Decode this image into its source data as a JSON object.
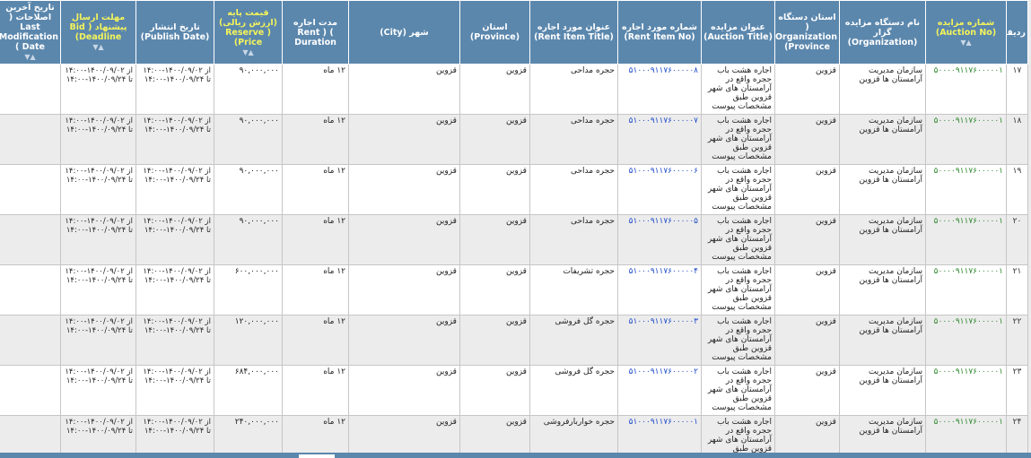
{
  "headers": {
    "row": "ردیف",
    "auction_no": "شماره مزایده (Auction No)",
    "org_name": "نام دستگاه مزایده گزار (Organization)",
    "org_province": "استان دستگاه ( Organization (Province",
    "auction_title": "عنوان مزایده (Auction Title)",
    "item_no": "شماره مورد اجاره (Rent Item No)",
    "item_title": "عنوان مورد اجاره (Rent Item Title)",
    "province": "استان (Province)",
    "city": "شهر (City)",
    "duration": "مدت اجاره Rent ) ( Duration",
    "price": "قیمت پایه (ارزش ریالی) ( Reserve (Price",
    "publish": "تاریخ انتشار (Publish Date)",
    "deadline": "مهلت ارسال پیشنهاد ( Bid (Deadline",
    "lastmod": "تاریخ آخرین اصلاحات ( Last Modification ( Date"
  },
  "rows": [
    {
      "rn": "۱۷",
      "auction_no": "۵۰۰۰۰۹۱۱۷۶۰۰۰۰۰۱",
      "org": "سازمان مدیریت آرامستان ها قزوین",
      "org_province": "قزوین",
      "title": "اجاره هشت باب حجره واقع در آرامستان های شهر قزوین طبق مشخصات پیوست",
      "item_no": "۵۱۰۰۰۹۱۱۷۶۰۰۰۰۰۸",
      "item_title": "حجره مداحی",
      "province": "قزوین",
      "city": "قزوین",
      "duration": "۱۲ ماه",
      "price": "۹۰,۰۰۰,۰۰۰",
      "publish_from": "از ۱۴۰۰/۰۹/۰۲-۱۴:۰۰",
      "publish_to": "تا ۱۴۰۰/۰۹/۲۴-۱۴:۰۰",
      "deadline_from": "از ۱۴۰۰/۰۹/۰۲-۱۴:۰۰",
      "deadline_to": "تا ۱۴۰۰/۰۹/۲۴-۱۴:۰۰",
      "lastmod": ""
    },
    {
      "rn": "۱۸",
      "auction_no": "۵۰۰۰۰۹۱۱۷۶۰۰۰۰۰۱",
      "org": "سازمان مدیریت آرامستان ها قزوین",
      "org_province": "قزوین",
      "title": "اجاره هشت باب حجره واقع در آرامستان های شهر قزوین طبق مشخصات پیوست",
      "item_no": "۵۱۰۰۰۹۱۱۷۶۰۰۰۰۰۷",
      "item_title": "حجره مداحی",
      "province": "قزوین",
      "city": "قزوین",
      "duration": "۱۲ ماه",
      "price": "۹۰,۰۰۰,۰۰۰",
      "publish_from": "از ۱۴۰۰/۰۹/۰۲-۱۴:۰۰",
      "publish_to": "تا ۱۴۰۰/۰۹/۲۴-۱۴:۰۰",
      "deadline_from": "از ۱۴۰۰/۰۹/۰۲-۱۴:۰۰",
      "deadline_to": "تا ۱۴۰۰/۰۹/۲۴-۱۴:۰۰",
      "lastmod": ""
    },
    {
      "rn": "۱۹",
      "auction_no": "۵۰۰۰۰۹۱۱۷۶۰۰۰۰۰۱",
      "org": "سازمان مدیریت آرامستان ها قزوین",
      "org_province": "قزوین",
      "title": "اجاره هشت باب حجره واقع در آرامستان های شهر قزوین طبق مشخصات پیوست",
      "item_no": "۵۱۰۰۰۹۱۱۷۶۰۰۰۰۰۶",
      "item_title": "حجره مداحی",
      "province": "قزوین",
      "city": "قزوین",
      "duration": "۱۲ ماه",
      "price": "۹۰,۰۰۰,۰۰۰",
      "publish_from": "از ۱۴۰۰/۰۹/۰۲-۱۴:۰۰",
      "publish_to": "تا ۱۴۰۰/۰۹/۲۴-۱۴:۰۰",
      "deadline_from": "از ۱۴۰۰/۰۹/۰۲-۱۴:۰۰",
      "deadline_to": "تا ۱۴۰۰/۰۹/۲۴-۱۴:۰۰",
      "lastmod": ""
    },
    {
      "rn": "۲۰",
      "auction_no": "۵۰۰۰۰۹۱۱۷۶۰۰۰۰۰۱",
      "org": "سازمان مدیریت آرامستان ها قزوین",
      "org_province": "قزوین",
      "title": "اجاره هشت باب حجره واقع در آرامستان های شهر قزوین طبق مشخصات پیوست",
      "item_no": "۵۱۰۰۰۹۱۱۷۶۰۰۰۰۰۵",
      "item_title": "حجره مداحی",
      "province": "قزوین",
      "city": "قزوین",
      "duration": "۱۲ ماه",
      "price": "۹۰,۰۰۰,۰۰۰",
      "publish_from": "از ۱۴۰۰/۰۹/۰۲-۱۴:۰۰",
      "publish_to": "تا ۱۴۰۰/۰۹/۲۴-۱۴:۰۰",
      "deadline_from": "از ۱۴۰۰/۰۹/۰۲-۱۴:۰۰",
      "deadline_to": "تا ۱۴۰۰/۰۹/۲۴-۱۴:۰۰",
      "lastmod": ""
    },
    {
      "rn": "۲۱",
      "auction_no": "۵۰۰۰۰۹۱۱۷۶۰۰۰۰۰۱",
      "org": "سازمان مدیریت آرامستان ها قزوین",
      "org_province": "قزوین",
      "title": "اجاره هشت باب حجره واقع در آرامستان های شهر قزوین طبق مشخصات پیوست",
      "item_no": "۵۱۰۰۰۹۱۱۷۶۰۰۰۰۰۴",
      "item_title": "حجره تشریفات",
      "province": "قزوین",
      "city": "قزوین",
      "duration": "۱۲ ماه",
      "price": "۶۰۰,۰۰۰,۰۰۰",
      "publish_from": "از ۱۴۰۰/۰۹/۰۲-۱۴:۰۰",
      "publish_to": "تا ۱۴۰۰/۰۹/۲۴-۱۴:۰۰",
      "deadline_from": "از ۱۴۰۰/۰۹/۰۲-۱۴:۰۰",
      "deadline_to": "تا ۱۴۰۰/۰۹/۲۴-۱۴:۰۰",
      "lastmod": ""
    },
    {
      "rn": "۲۲",
      "auction_no": "۵۰۰۰۰۹۱۱۷۶۰۰۰۰۰۱",
      "org": "سازمان مدیریت آرامستان ها قزوین",
      "org_province": "قزوین",
      "title": "اجاره هشت باب حجره واقع در آرامستان های شهر قزوین طبق مشخصات پیوست",
      "item_no": "۵۱۰۰۰۹۱۱۷۶۰۰۰۰۰۳",
      "item_title": "حجره گل فروشی",
      "province": "قزوین",
      "city": "قزوین",
      "duration": "۱۲ ماه",
      "price": "۱۲۰,۰۰۰,۰۰۰",
      "publish_from": "از ۱۴۰۰/۰۹/۰۲-۱۴:۰۰",
      "publish_to": "تا ۱۴۰۰/۰۹/۲۴-۱۴:۰۰",
      "deadline_from": "از ۱۴۰۰/۰۹/۰۲-۱۴:۰۰",
      "deadline_to": "تا ۱۴۰۰/۰۹/۲۴-۱۴:۰۰",
      "lastmod": ""
    },
    {
      "rn": "۲۳",
      "auction_no": "۵۰۰۰۰۹۱۱۷۶۰۰۰۰۰۱",
      "org": "سازمان مدیریت آرامستان ها قزوین",
      "org_province": "قزوین",
      "title": "اجاره هشت باب حجره واقع در آرامستان های شهر قزوین طبق مشخصات پیوست",
      "item_no": "۵۱۰۰۰۹۱۱۷۶۰۰۰۰۰۲",
      "item_title": "حجره گل فروشی",
      "province": "قزوین",
      "city": "قزوین",
      "duration": "۱۲ ماه",
      "price": "۶۸۴,۰۰۰,۰۰۰",
      "publish_from": "از ۱۴۰۰/۰۹/۰۲-۱۴:۰۰",
      "publish_to": "تا ۱۴۰۰/۰۹/۲۴-۱۴:۰۰",
      "deadline_from": "از ۱۴۰۰/۰۹/۰۲-۱۴:۰۰",
      "deadline_to": "تا ۱۴۰۰/۰۹/۲۴-۱۴:۰۰",
      "lastmod": ""
    },
    {
      "rn": "۲۴",
      "auction_no": "۵۰۰۰۰۹۱۱۷۶۰۰۰۰۰۱",
      "org": "سازمان مدیریت آرامستان ها قزوین",
      "org_province": "قزوین",
      "title": "اجاره هشت باب حجره واقع در آرامستان های شهر قزوین طبق مشخصات پیوست",
      "item_no": "۵۱۰۰۰۹۱۱۷۶۰۰۰۰۰۱",
      "item_title": "حجره خواربارفروشی",
      "province": "قزوین",
      "city": "قزوین",
      "duration": "۱۲ ماه",
      "price": "۲۴۰,۰۰۰,۰۰۰",
      "publish_from": "از ۱۴۰۰/۰۹/۰۲-۱۴:۰۰",
      "publish_to": "تا ۱۴۰۰/۰۹/۲۴-۱۴:۰۰",
      "deadline_from": "از ۱۴۰۰/۰۹/۰۲-۱۴:۰۰",
      "deadline_to": "تا ۱۴۰۰/۰۹/۲۴-۱۴:۰۰",
      "lastmod": ""
    }
  ]
}
